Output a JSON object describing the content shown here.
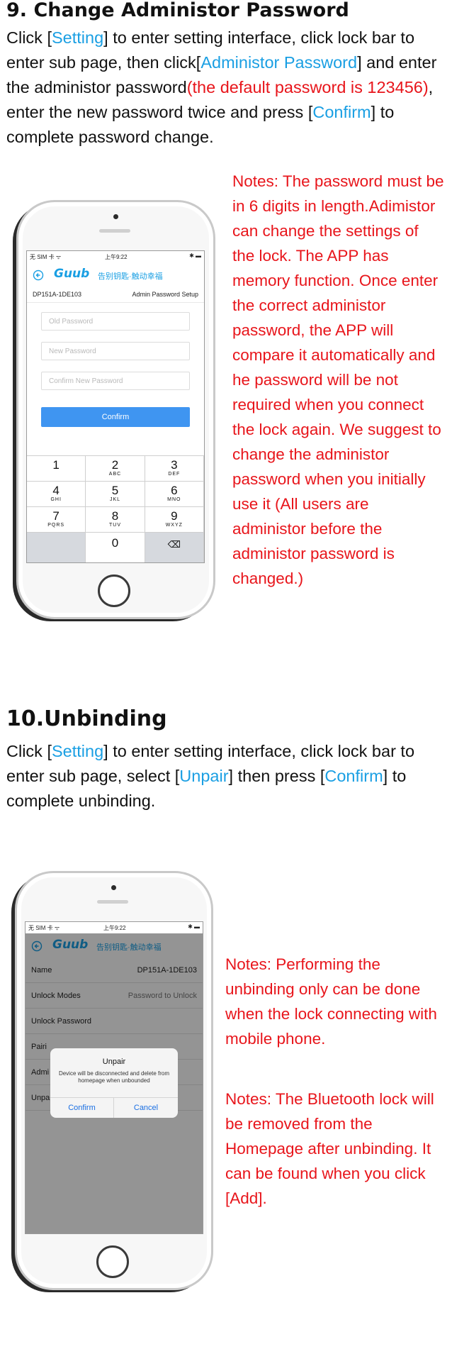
{
  "section9": {
    "heading": "9. Change Administor Password",
    "para": {
      "p1": "Click [",
      "setting": "Setting",
      "p2": "] to enter setting interface, click lock bar to enter sub page, then click[",
      "admin_pw": "Administor Password",
      "p3": "] and enter the administor password",
      "default_note": "(the default password is 123456)",
      "p4": ", enter the new password twice and press [",
      "confirm": "Confirm",
      "p5": "] to complete password change."
    },
    "notes": "Notes: The password must be in 6 digits in length.Adimistor can change the settings of the lock. The APP has memory function. Once enter the correct administor password, the APP will compare it automatically and he password will be not required when you connect the lock again. We suggest to change the administor password when you initially use it (All users are administor before the administor password is changed.)",
    "phone": {
      "status_left": "无 SIM 卡 ᯤ",
      "status_time": "上午9:22",
      "status_right": "✱ ▬",
      "logo": "Guub",
      "slogan": "告别钥匙·触动幸福",
      "device_id": "DP151A-1DE103",
      "page_title": "Admin Password Setup",
      "old_pw_placeholder": "Old Password",
      "new_pw_placeholder": "New Password",
      "confirm_pw_placeholder": "Confirm New Password",
      "confirm_button": "Confirm",
      "keys": [
        {
          "num": "1",
          "letters": ""
        },
        {
          "num": "2",
          "letters": "ABC"
        },
        {
          "num": "3",
          "letters": "DEF"
        },
        {
          "num": "4",
          "letters": "GHI"
        },
        {
          "num": "5",
          "letters": "JKL"
        },
        {
          "num": "6",
          "letters": "MNO"
        },
        {
          "num": "7",
          "letters": "PQRS"
        },
        {
          "num": "8",
          "letters": "TUV"
        },
        {
          "num": "9",
          "letters": "WXYZ"
        },
        {
          "num": "",
          "letters": ""
        },
        {
          "num": "0",
          "letters": ""
        },
        {
          "num": "⌫",
          "letters": ""
        }
      ]
    }
  },
  "section10": {
    "heading": "10.Unbinding",
    "para": {
      "p1": "Click [",
      "setting": "Setting",
      "p2": "] to enter setting interface, click lock bar to enter sub page, select [",
      "unpair": "Unpair",
      "p3": "]  then press [",
      "confirm": "Confirm",
      "p4": "] to complete unbinding."
    },
    "notes1": "Notes: Performing the unbinding only can be done when the lock connecting with mobile phone.",
    "notes2": "Notes: The Bluetooth lock will be removed from the Homepage after unbinding. It can be found when you click [Add].",
    "phone": {
      "status_left": "无 SIM 卡 ᯤ",
      "status_time": "上午9:22",
      "status_right": "✱ ▬",
      "logo": "Guub",
      "slogan": "告别钥匙·触动幸福",
      "rows": [
        {
          "label": "Name",
          "value": "DP151A-1DE103"
        },
        {
          "label": "Unlock Modes",
          "value": "Password to Unlock"
        },
        {
          "label": "Unlock Password",
          "value": ""
        },
        {
          "label": "Pairi",
          "value": ""
        },
        {
          "label": "Admi",
          "value": ""
        },
        {
          "label": "Unpa",
          "value": ""
        }
      ],
      "dialog_title": "Unpair",
      "dialog_message": "Device will be disconnected and delete from homepage when unbounded",
      "dialog_confirm": "Confirm",
      "dialog_cancel": "Cancel"
    }
  },
  "colors": {
    "highlight": "#1a9fe3",
    "notes_red": "#e8151b",
    "app_button": "#3f95f1"
  }
}
